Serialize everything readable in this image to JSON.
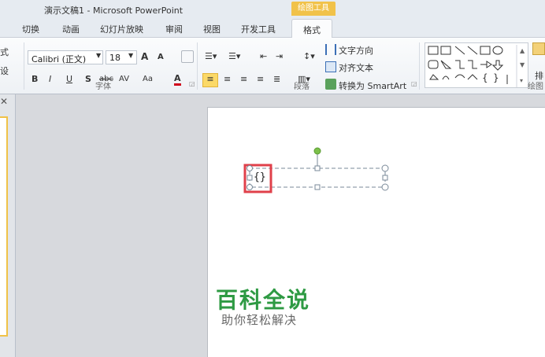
{
  "window": {
    "title": "演示文稿1 - Microsoft PowerPoint",
    "context_tab": "绘图工具"
  },
  "tabs": [
    "切换",
    "动画",
    "幻灯片放映",
    "审阅",
    "视图",
    "开发工具",
    "格式"
  ],
  "left_cut_labels": [
    "式",
    "设"
  ],
  "font": {
    "name": "Calibri (正文)",
    "size": "18"
  },
  "font_buttons": {
    "grow": "A",
    "shrink": "A",
    "bold": "B",
    "italic": "I",
    "underline": "U",
    "shadow": "S",
    "strike": "abc",
    "spacing": "AV",
    "case": "Aa",
    "color": "A"
  },
  "paragraph": {
    "text_direction": "文字方向",
    "align_text": "对齐文本",
    "smartart": "转换为 SmartArt"
  },
  "groups": {
    "font": "字体",
    "paragraph": "段落",
    "drawing": "绘图"
  },
  "arrange_cut": "排",
  "textbox": {
    "content": "{}"
  },
  "watermark": {
    "title": "百科全说",
    "subtitle": "助你轻松解决"
  },
  "colors": {
    "highlight_box": "#e0404a",
    "context_tab": "#f1c24a",
    "watermark": "#2e9a43",
    "rotate_handle": "#7cc04a"
  }
}
